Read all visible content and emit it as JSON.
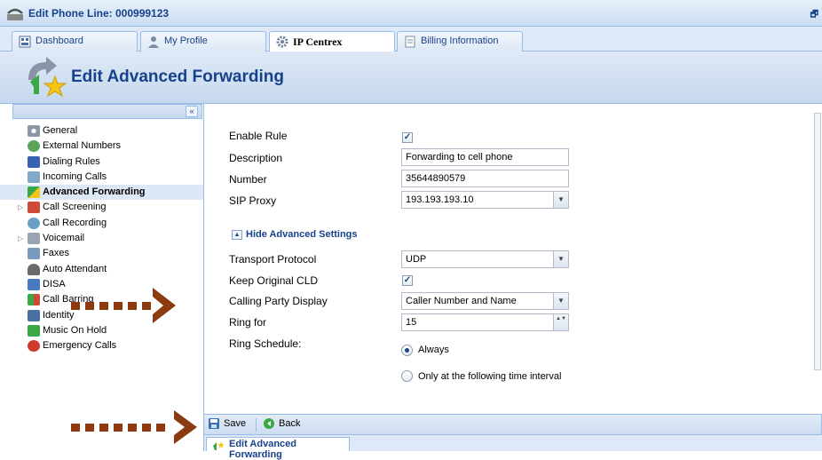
{
  "window": {
    "title": "Edit Phone Line: 000999123",
    "app_icon": "phone-icon",
    "restore_glyph": "🗗"
  },
  "tabs": [
    {
      "label": "Dashboard",
      "icon": "dashboard-icon"
    },
    {
      "label": "My Profile",
      "icon": "user-icon"
    },
    {
      "label": "IP Centrex",
      "icon": "gear-icon"
    },
    {
      "label": "Billing Information",
      "icon": "document-icon"
    }
  ],
  "header": {
    "title": "Edit Advanced Forwarding",
    "icon": "forwarding-star-icon"
  },
  "sidebar": {
    "collapse_glyph": "«",
    "items": [
      {
        "label": "General",
        "icon": "gear-icon"
      },
      {
        "label": "External Numbers",
        "icon": "globe-icon"
      },
      {
        "label": "Dialing Rules",
        "icon": "keypad-icon"
      },
      {
        "label": "Incoming Calls",
        "icon": "incoming-call-icon"
      },
      {
        "label": "Advanced Forwarding",
        "icon": "forwarding-icon"
      },
      {
        "label": "Call Screening",
        "icon": "screening-icon"
      },
      {
        "label": "Call Recording",
        "icon": "recording-icon"
      },
      {
        "label": "Voicemail",
        "icon": "voicemail-icon"
      },
      {
        "label": "Faxes",
        "icon": "fax-icon"
      },
      {
        "label": "Auto Attendant",
        "icon": "attendant-icon"
      },
      {
        "label": "DISA",
        "icon": "disa-icon"
      },
      {
        "label": "Call Barring",
        "icon": "barring-icon"
      },
      {
        "label": "Identity",
        "icon": "identity-icon"
      },
      {
        "label": "Music On Hold",
        "icon": "music-icon"
      },
      {
        "label": "Emergency Calls",
        "icon": "emergency-icon"
      }
    ],
    "selected_index": 4
  },
  "form": {
    "enable_rule": {
      "label": "Enable Rule",
      "checked": true
    },
    "description": {
      "label": "Description",
      "value": "Forwarding to cell phone"
    },
    "number": {
      "label": "Number",
      "value": "35644890579"
    },
    "sip_proxy": {
      "label": "SIP Proxy",
      "value": "193.193.193.10"
    },
    "advanced_toggle": "Hide Advanced Settings",
    "transport_protocol": {
      "label": "Transport Protocol",
      "value": "UDP"
    },
    "keep_original_cld": {
      "label": "Keep Original CLD",
      "checked": true
    },
    "calling_party_display": {
      "label": "Calling Party Display",
      "value": "Caller Number and Name"
    },
    "ring_for": {
      "label": "Ring for",
      "value": "15"
    },
    "ring_schedule": {
      "label": "Ring Schedule:",
      "options": [
        "Always",
        "Only at the following time interval"
      ],
      "selected": "Always"
    }
  },
  "glyphs": {
    "check": "✓",
    "dropdown": "▼",
    "spin": "▲▼",
    "collapse_up": "▲"
  },
  "toolbar": {
    "save_label": "Save",
    "back_label": "Back"
  },
  "bottom_tab": {
    "label": "Edit Advanced Forwarding"
  },
  "colors": {
    "accent": "#15428b",
    "annotation_arrow": "#8b3a12",
    "panel_border": "#99bbe8"
  }
}
